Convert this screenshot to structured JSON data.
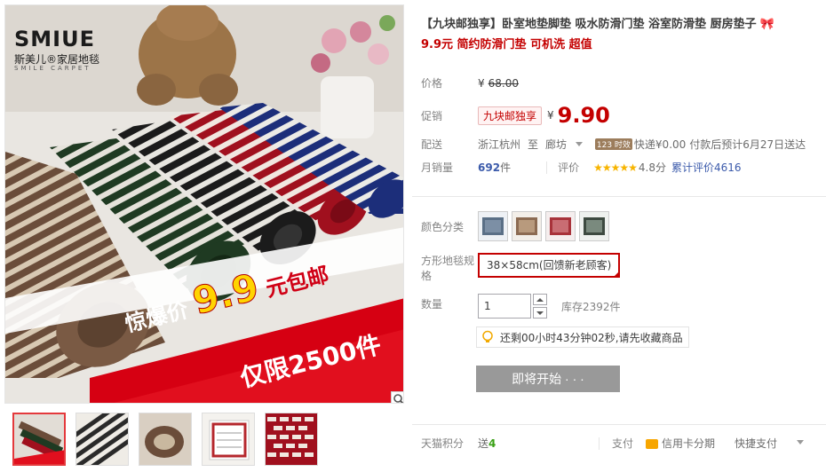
{
  "brand": {
    "word": "SMIUE",
    "cn": "斯美儿®家居地毯",
    "en": "SMILE CARPET"
  },
  "promo": {
    "line1_prefix": "惊爆价",
    "line1_price": "9.9",
    "line1_suffix": "元包邮",
    "line2": "仅限2500件"
  },
  "product": {
    "title": "【九块邮独享】卧室地垫脚垫 吸水防滑门垫 浴室防滑垫 厨房垫子",
    "title_icon": "bow-icon",
    "subtitle": "9.9元 简约防滑门垫 可机洗 超值"
  },
  "price": {
    "label": "价格",
    "currency": "¥",
    "original": "68.00"
  },
  "promotion": {
    "label": "促销",
    "tag": "九块邮独享",
    "currency": "¥",
    "price": "9.90"
  },
  "delivery": {
    "label": "配送",
    "from": "浙江杭州",
    "to_word": "至",
    "to": "廊坊",
    "badge": "123 时效",
    "express": "快递¥0.00",
    "eta": "付款后预计6月27日送达"
  },
  "sales": {
    "label": "月销量",
    "count": "692",
    "unit": "件",
    "review_label": "评价",
    "stars": "★★★★★",
    "score": "4.8分",
    "total": "累计评价4616"
  },
  "sku": {
    "color_label": "颜色分类",
    "colors": [
      "grey-blue",
      "brown",
      "red",
      "green"
    ],
    "size_label": "方形地毯规",
    "size_label_wrap": "格",
    "size_value": "38×58cm(回馈新老顾客)"
  },
  "quantity": {
    "label": "数量",
    "value": "1",
    "stock": "库存2392件"
  },
  "notice": {
    "text": "还剩00小时43分钟02秒,请先收藏商品"
  },
  "start_button": {
    "label": "即将开始 · · ·"
  },
  "bottom": {
    "points_label": "天猫积分",
    "points_value": "送",
    "points_num": "4",
    "pay_label": "支付",
    "pay_method": "信用卡分期",
    "pay_fast": "快捷支付"
  },
  "colors": {
    "accent_red": "#c40000",
    "button_grey": "#999999",
    "star_gold": "#f7b400",
    "link_blue": "#3c5bab"
  }
}
